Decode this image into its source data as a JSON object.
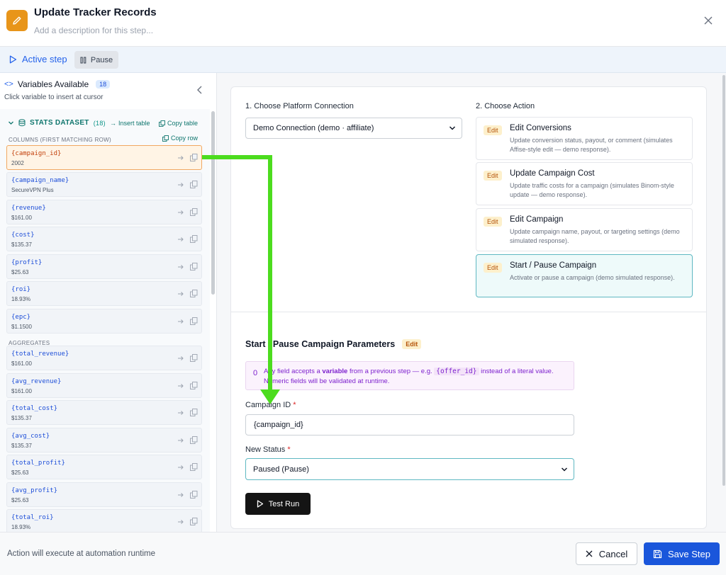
{
  "header": {
    "title": "Update Tracker Records",
    "description_placeholder": "Add a description for this step..."
  },
  "stepbar": {
    "active_label": "Active step",
    "pause_label": "Pause"
  },
  "sidebar": {
    "title": "Variables Available",
    "count": "18",
    "subtitle": "Click variable to insert at cursor",
    "dataset": {
      "name": "STATS DATASET",
      "count": "(18)",
      "insert_table": "Insert table",
      "copy_table": "Copy table",
      "copy_row": "Copy row",
      "columns_label": "COLUMNS (FIRST MATCHING ROW)",
      "aggregates_label": "AGGREGATES",
      "columns": [
        {
          "name": "{campaign_id}",
          "value": "2002"
        },
        {
          "name": "{campaign_name}",
          "value": "SecureVPN Plus"
        },
        {
          "name": "{revenue}",
          "value": "$161.00"
        },
        {
          "name": "{cost}",
          "value": "$135.37"
        },
        {
          "name": "{profit}",
          "value": "$25.63"
        },
        {
          "name": "{roi}",
          "value": "18.93%"
        },
        {
          "name": "{epc}",
          "value": "$1.1500"
        }
      ],
      "aggregates": [
        {
          "name": "{total_revenue}",
          "value": "$161.00"
        },
        {
          "name": "{avg_revenue}",
          "value": "$161.00"
        },
        {
          "name": "{total_cost}",
          "value": "$135.37"
        },
        {
          "name": "{avg_cost}",
          "value": "$135.37"
        },
        {
          "name": "{total_profit}",
          "value": "$25.63"
        },
        {
          "name": "{avg_profit}",
          "value": "$25.63"
        },
        {
          "name": "{total_roi}",
          "value": "18.93%"
        }
      ]
    }
  },
  "main": {
    "platform_label": "1. Choose Platform Connection",
    "platform_value": "Demo Connection (demo · affiliate)",
    "action_label": "2. Choose Action",
    "actions": [
      {
        "badge": "Edit",
        "title": "Edit Conversions",
        "desc": "Update conversion status, payout, or comment (simulates Affise-style edit — demo response)."
      },
      {
        "badge": "Edit",
        "title": "Update Campaign Cost",
        "desc": "Update traffic costs for a campaign (simulates Binom-style update — demo response)."
      },
      {
        "badge": "Edit",
        "title": "Edit Campaign",
        "desc": "Update campaign name, payout, or targeting settings (demo simulated response)."
      },
      {
        "badge": "Edit",
        "title": "Start / Pause Campaign",
        "desc": "Activate or pause a campaign (demo simulated response)."
      }
    ],
    "params_title": "Start / Pause Campaign Parameters",
    "params_badge": "Edit",
    "info": {
      "icon_char": "0",
      "pre": "Any field accepts a ",
      "bold": "variable",
      "mid": " from a previous step — e.g. ",
      "code": "{offer_id}",
      "post": " instead of a literal value.",
      "line2": "Numeric fields will be validated at runtime."
    },
    "campaign_id_label": "Campaign ID",
    "campaign_id_value": "{campaign_id}",
    "status_label": "New Status",
    "status_value": "Paused (Pause)",
    "required_mark": "*",
    "test_run": "Test Run"
  },
  "footer": {
    "note": "Action will execute at automation runtime",
    "cancel": "Cancel",
    "save": "Save Step"
  },
  "colors": {
    "accent": "#1a56db",
    "header_icon": "#e8951a",
    "arrow": "#4cdc1e"
  }
}
